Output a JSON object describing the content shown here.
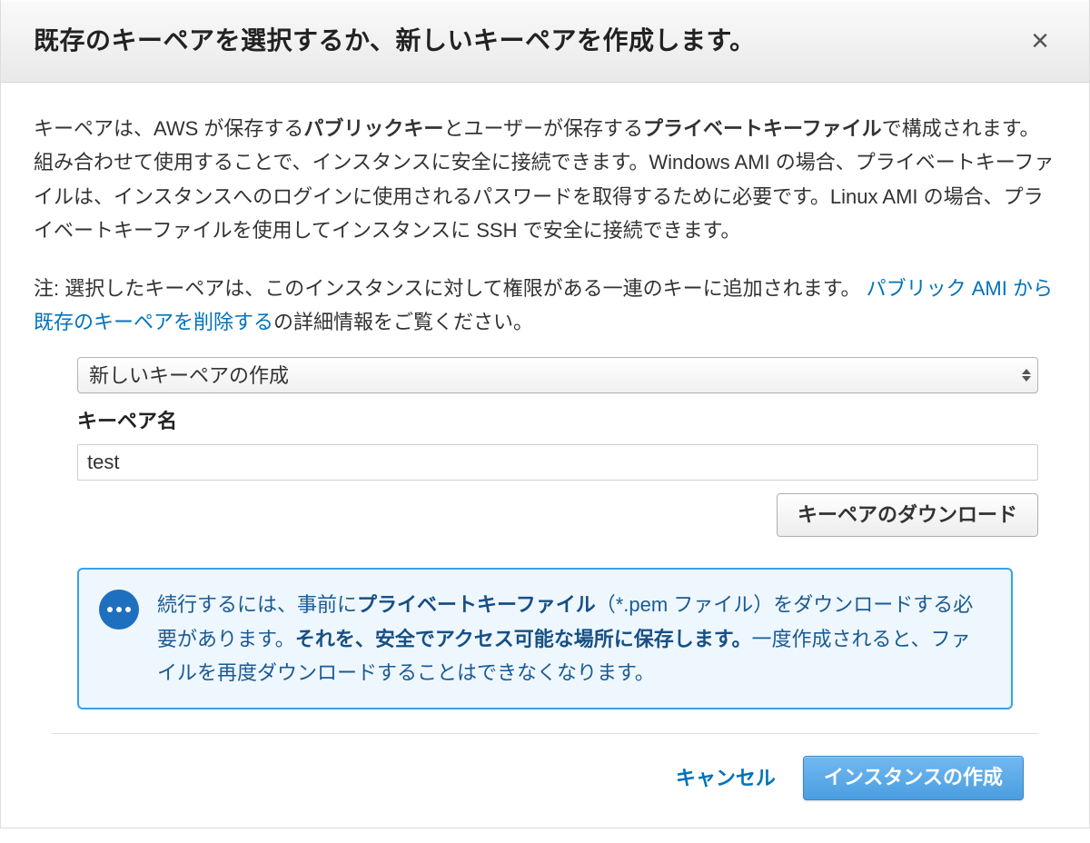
{
  "dialog": {
    "title": "既存のキーペアを選択するか、新しいキーペアを作成します。",
    "close_label": "×"
  },
  "intro": {
    "t1": "キーペアは、AWS が保存する",
    "b1": "パブリックキー",
    "t2": "とユーザーが保存する",
    "b2": "プライベートキーファイル",
    "t3": "で構成されます。組み合わせて使用することで、インスタンスに安全に接続できます。Windows AMI の場合、プライベートキーファイルは、インスタンスへのログインに使用されるパスワードを取得するために必要です。Linux AMI の場合、プライベートキーファイルを使用してインスタンスに SSH で安全に接続できます。"
  },
  "note": {
    "prefix": "注: 選択したキーペアは、このインスタンスに対して権限がある一連のキーに追加されます。",
    "link": "パブリック AMI から既存のキーペアを削除する",
    "suffix": "の詳細情報をご覧ください。"
  },
  "select": {
    "selected": "新しいキーペアの作成"
  },
  "keypair_name": {
    "label": "キーペア名",
    "value": "test"
  },
  "buttons": {
    "download": "キーペアのダウンロード",
    "cancel": "キャンセル",
    "launch": "インスタンスの作成"
  },
  "info": {
    "t1": "続行するには、事前に",
    "b1": "プライベートキーファイル",
    "t2": "（*.pem ファイル）をダウンロードする必要があります。",
    "b2": "それを、安全でアクセス可能な場所に保存します。",
    "t3": "一度作成されると、ファイルを再度ダウンロードすることはできなくなります。"
  }
}
